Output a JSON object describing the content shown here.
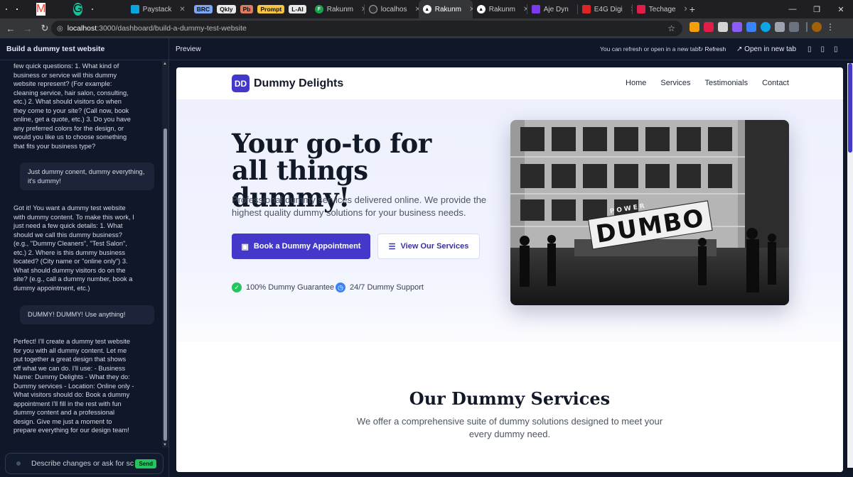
{
  "browser": {
    "pinned_tabs": [
      "#1f1f23",
      "#1f1f23",
      "#1f1f23",
      "#1f1f23",
      "#1f1f23",
      "#1f1f23",
      "#1f1f23",
      "#1f1f23",
      "#1f1f23",
      "#1f1f23"
    ],
    "tabs": [
      {
        "label": "Paystack",
        "active": false
      },
      {
        "label": "BRC",
        "pill": true,
        "color": "#7ea6f0"
      },
      {
        "label": "Qkly",
        "pill": true,
        "color": "#e8e8e8"
      },
      {
        "label": "Pb",
        "pill": true,
        "color": "#e07a5f"
      },
      {
        "label": "Prompt",
        "pill": true,
        "color": "#f5c542"
      },
      {
        "label": "L-AI",
        "pill": true,
        "color": "#e8e8e8"
      },
      {
        "label": "Rakunm",
        "active": false
      },
      {
        "label": "localhos",
        "active": false
      },
      {
        "label": "Rakunm",
        "active": true
      },
      {
        "label": "Rakunm",
        "active": false
      },
      {
        "label": "Aje Dyn",
        "active": false
      },
      {
        "label": "E4G Digi",
        "active": false
      },
      {
        "label": "Techage",
        "active": false
      }
    ],
    "address": {
      "host": "localhost",
      "path": ":3000/dashboard/build-a-dummy-test-website"
    }
  },
  "sidebar": {
    "title": "Build a dummy test website",
    "messages": [
      {
        "role": "assistant",
        "text": "few quick questions: 1. What kind of business or service will this dummy website represent? (For example: cleaning service, hair salon, consulting, etc.) 2. What should visitors do when they come to your site? (Call now, book online, get a quote, etc.) 3. Do you have any preferred colors for the design, or would you like us to choose something that fits your business type?"
      },
      {
        "role": "user",
        "text": "Just dummy conent, dummy everything, it's dummy!"
      },
      {
        "role": "assistant",
        "text": "Got it! You want a dummy test website with dummy content. To make this work, I just need a few quick details: 1. What should we call this dummy business? (e.g., \"Dummy Cleaners\", \"Test Salon\", etc.) 2. Where is this dummy business located? (City name or \"online only\") 3. What should dummy visitors do on the site? (e.g., call a dummy number, book a dummy appointment, etc.)"
      },
      {
        "role": "user",
        "text": "DUMMY! DUMMY! Use anything!"
      },
      {
        "role": "assistant",
        "text": "Perfect! I'll create a dummy test website for you with all dummy content. Let me put together a great design that shows off what we can do. I'll use: - Business Name: Dummy Delights - What they do: Dummy services - Location: Online only - What visitors should do: Book a dummy appointment I'll fill in the rest with fun dummy content and a professional design. Give me just a moment to prepare everything for our design team!"
      }
    ],
    "input_placeholder": "Describe changes or ask for sc",
    "send_label": "Send"
  },
  "preview": {
    "label": "Preview",
    "hint": "You can refresh or open in a new tab.",
    "refresh_label": "Refresh",
    "open_label": "Open in new tab"
  },
  "site": {
    "logo_badge": "DD",
    "brand": "Dummy Delights",
    "nav": [
      "Home",
      "Services",
      "Testimonials",
      "Contact"
    ],
    "hero_title": "Your go-to for all things dummy!",
    "hero_sub": "Professional dummy services delivered online. We provide the highest quality dummy solutions for your business needs.",
    "cta_primary": "Book a Dummy Appointment",
    "cta_secondary": "View Our Services",
    "features": [
      "100% Dummy Guarantee",
      "24/7 Dummy Support"
    ],
    "photo_sign_small": "POWER",
    "photo_sign": "DUMBO",
    "services_title": "Our Dummy Services",
    "services_sub": "We offer a comprehensive suite of dummy solutions designed to meet your every dummy need."
  },
  "colors": {
    "accent": "#4338ca",
    "check": "#22c55e",
    "clock": "#3b82f6"
  }
}
